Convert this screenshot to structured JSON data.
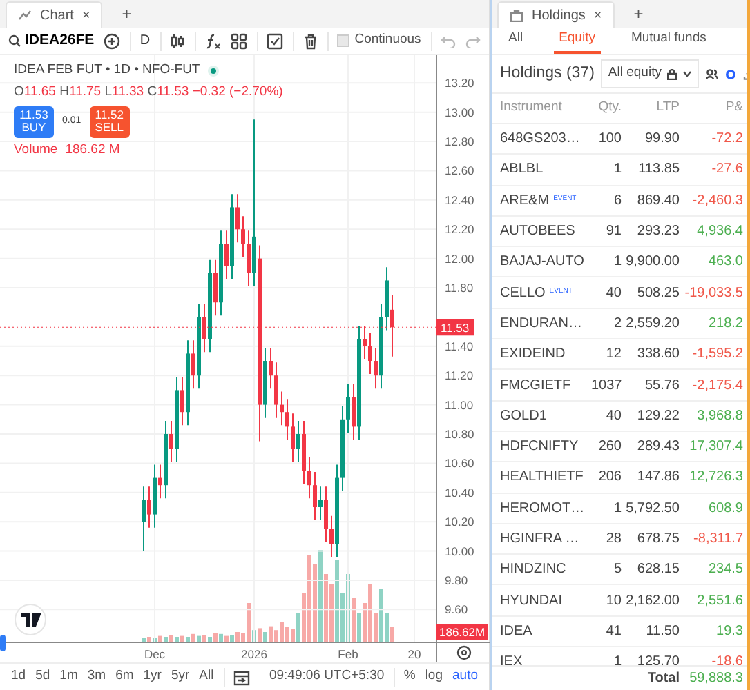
{
  "chart_tab": {
    "title": "Chart",
    "close": "×",
    "add": "+"
  },
  "toolbar": {
    "symbol": "IDEA26FE",
    "interval": "D",
    "continuous": {
      "label": "Continuous",
      "checked": false
    }
  },
  "legend": {
    "title": "IDEA FEB FUT • 1D • NFO-FUT",
    "ohlc": [
      {
        "label": "O",
        "value": "11.65"
      },
      {
        "label": "H",
        "value": "11.75"
      },
      {
        "label": "L",
        "value": "11.33"
      },
      {
        "label": "C",
        "value": "11.53"
      }
    ],
    "change": "−0.32 (−2.70%)",
    "buy": {
      "price": "11.53",
      "label": "BUY"
    },
    "spread": "0.01",
    "sell": {
      "price": "11.52",
      "label": "SELL"
    },
    "volume": {
      "label": "Volume",
      "value": "186.62 M"
    }
  },
  "chart": {
    "chart_data": {
      "type": "candlestick",
      "grid": true,
      "categories": [
        null,
        null,
        "Dec",
        null,
        null,
        null,
        null,
        null,
        null,
        null,
        null,
        null,
        null,
        null,
        null,
        null,
        null,
        null,
        null,
        null,
        "2026",
        null,
        null,
        null,
        null,
        null,
        null,
        null,
        null,
        null,
        null,
        null,
        null,
        null,
        null,
        null,
        null,
        "Feb",
        null,
        null,
        null,
        null,
        null,
        null,
        null,
        null,
        null,
        null,
        null,
        "20"
      ],
      "ohlc": [
        [
          10.2,
          10.44,
          10.0,
          10.35
        ],
        [
          10.35,
          10.44,
          10.16,
          10.25
        ],
        [
          10.25,
          10.59,
          10.16,
          10.5
        ],
        [
          10.5,
          10.59,
          10.36,
          10.45
        ],
        [
          10.45,
          10.89,
          10.36,
          10.8
        ],
        [
          10.8,
          10.89,
          10.61,
          10.7
        ],
        [
          10.7,
          11.19,
          10.61,
          11.1
        ],
        [
          11.1,
          11.19,
          10.86,
          10.95
        ],
        [
          10.95,
          11.44,
          10.86,
          11.35
        ],
        [
          11.35,
          11.44,
          11.11,
          11.2
        ],
        [
          11.2,
          11.69,
          11.11,
          11.6
        ],
        [
          11.6,
          11.69,
          11.36,
          11.45
        ],
        [
          11.45,
          11.99,
          11.36,
          11.9
        ],
        [
          11.9,
          11.99,
          11.61,
          11.7
        ],
        [
          11.7,
          12.19,
          11.61,
          12.1
        ],
        [
          12.1,
          12.19,
          11.86,
          11.95
        ],
        [
          11.95,
          12.44,
          11.86,
          12.35
        ],
        [
          12.35,
          12.44,
          12.11,
          12.2
        ],
        [
          12.2,
          12.29,
          12.01,
          12.1
        ],
        [
          12.1,
          12.19,
          11.81,
          11.9
        ],
        [
          11.9,
          12.95,
          11.81,
          12.15
        ],
        [
          12.0,
          12.09,
          10.75,
          11.0
        ],
        [
          11.0,
          11.39,
          10.91,
          11.3
        ],
        [
          11.3,
          11.39,
          11.11,
          11.2
        ],
        [
          11.2,
          11.29,
          10.91,
          11.0
        ],
        [
          11.0,
          11.09,
          10.86,
          10.95
        ],
        [
          10.95,
          11.04,
          10.76,
          10.85
        ],
        [
          10.85,
          10.94,
          10.61,
          10.7
        ],
        [
          10.7,
          10.89,
          10.61,
          10.8
        ],
        [
          10.8,
          10.89,
          10.46,
          10.55
        ],
        [
          10.55,
          10.64,
          10.36,
          10.45
        ],
        [
          10.45,
          10.54,
          10.21,
          10.3
        ],
        [
          10.3,
          10.44,
          10.21,
          10.35
        ],
        [
          10.35,
          10.44,
          10.06,
          10.15
        ],
        [
          10.15,
          10.24,
          9.96,
          10.05
        ],
        [
          10.05,
          10.59,
          9.96,
          10.5
        ],
        [
          10.5,
          10.99,
          10.41,
          10.9
        ],
        [
          10.9,
          11.14,
          10.81,
          11.05
        ],
        [
          11.05,
          11.14,
          10.76,
          10.85
        ],
        [
          10.85,
          11.54,
          10.76,
          11.45
        ],
        [
          11.45,
          11.54,
          11.31,
          11.4
        ],
        [
          11.4,
          11.49,
          11.21,
          11.3
        ],
        [
          11.3,
          11.39,
          11.11,
          11.2
        ],
        [
          11.2,
          11.69,
          11.11,
          11.6
        ],
        [
          11.6,
          11.94,
          11.51,
          11.85
        ],
        [
          11.65,
          11.75,
          11.33,
          11.53
        ],
        null,
        null,
        null,
        null
      ],
      "ylim": [
        9.38,
        13.39
      ],
      "yticks": [
        {
          "value": 13.2,
          "label": "13.20"
        },
        {
          "value": 13.0,
          "label": "13.00"
        },
        {
          "value": 12.8,
          "label": "12.80"
        },
        {
          "value": 12.6,
          "label": "12.60"
        },
        {
          "value": 12.4,
          "label": "12.40"
        },
        {
          "value": 12.2,
          "label": "12.20"
        },
        {
          "value": 12.0,
          "label": "12.00"
        },
        {
          "value": 11.8,
          "label": "11.80"
        },
        {
          "value": 11.4,
          "label": "11.40"
        },
        {
          "value": 11.2,
          "label": "11.20"
        },
        {
          "value": 11.0,
          "label": "11.00"
        },
        {
          "value": 10.8,
          "label": "10.80"
        },
        {
          "value": 10.6,
          "label": "10.60"
        },
        {
          "value": 10.4,
          "label": "10.40"
        },
        {
          "value": 10.2,
          "label": "10.20"
        },
        {
          "value": 10.0,
          "label": "10.00"
        },
        {
          "value": 9.8,
          "label": "9.80"
        },
        {
          "value": 9.6,
          "label": "9.60"
        }
      ]
    },
    "last_price": "11.53",
    "last_volume": "186.62M"
  },
  "range_bar": {
    "ranges": [
      "1d",
      "5d",
      "1m",
      "3m",
      "6m",
      "1yr",
      "5yr",
      "All"
    ],
    "time": "09:49:06 UTC+5:30",
    "toggles": [
      {
        "label": "%",
        "selected": false
      },
      {
        "label": "log",
        "selected": false
      },
      {
        "label": "auto",
        "selected": true
      }
    ]
  },
  "holdings_tab": {
    "title": "Holdings",
    "close": "×",
    "add": "+"
  },
  "segments": [
    {
      "label": "All",
      "selected": false
    },
    {
      "label": "Equity",
      "selected": true
    },
    {
      "label": "Mutual funds",
      "selected": false
    }
  ],
  "holdings": {
    "title": "Holdings (37)",
    "filter": "All equity",
    "columns": [
      "Instrument",
      "Qty.",
      "LTP",
      "P&"
    ],
    "rows": [
      {
        "instrument": "648GS203…",
        "qty": "100",
        "ltp": "99.90",
        "pnl": "-72.2",
        "color": "#f0584a"
      },
      {
        "instrument": "ABLBL",
        "qty": "1",
        "ltp": "113.85",
        "pnl": "-27.6",
        "color": "#f0584a"
      },
      {
        "instrument": "ARE&M",
        "event": "EVENT",
        "qty": "6",
        "ltp": "869.40",
        "pnl": "-2,460.3",
        "color": "#f0584a"
      },
      {
        "instrument": "AUTOBEES",
        "qty": "91",
        "ltp": "293.23",
        "pnl": "4,936.4",
        "color": "#4caf50"
      },
      {
        "instrument": "BAJAJ-AUTO",
        "qty": "1",
        "ltp": "9,900.00",
        "pnl": "463.0",
        "color": "#4caf50"
      },
      {
        "instrument": "CELLO",
        "event": "EVENT",
        "qty": "40",
        "ltp": "508.25",
        "pnl": "-19,033.5",
        "color": "#f0584a"
      },
      {
        "instrument": "ENDURAN…",
        "qty": "2",
        "ltp": "2,559.20",
        "pnl": "218.2",
        "color": "#4caf50"
      },
      {
        "instrument": "EXIDEIND",
        "qty": "12",
        "ltp": "338.60",
        "pnl": "-1,595.2",
        "color": "#f0584a"
      },
      {
        "instrument": "FMCGIETF",
        "qty": "1037",
        "ltp": "55.76",
        "pnl": "-2,175.4",
        "color": "#f0584a"
      },
      {
        "instrument": "GOLD1",
        "qty": "40",
        "ltp": "129.22",
        "pnl": "3,968.8",
        "color": "#4caf50"
      },
      {
        "instrument": "HDFCNIFTY",
        "qty": "260",
        "ltp": "289.43",
        "pnl": "17,307.4",
        "color": "#4caf50"
      },
      {
        "instrument": "HEALTHIETF",
        "qty": "206",
        "ltp": "147.86",
        "pnl": "12,726.3",
        "color": "#4caf50"
      },
      {
        "instrument": "HEROMOT…",
        "qty": "1",
        "ltp": "5,792.50",
        "pnl": "608.9",
        "color": "#4caf50"
      },
      {
        "instrument": "HGINFRA …",
        "qty": "28",
        "ltp": "678.75",
        "pnl": "-8,311.7",
        "color": "#f0584a"
      },
      {
        "instrument": "HINDZINC",
        "qty": "5",
        "ltp": "628.15",
        "pnl": "234.5",
        "color": "#4caf50"
      },
      {
        "instrument": "HYUNDAI",
        "qty": "10",
        "ltp": "2,162.00",
        "pnl": "2,551.6",
        "color": "#4caf50"
      },
      {
        "instrument": "IDEA",
        "qty": "41",
        "ltp": "11.50",
        "pnl": "19.3",
        "color": "#4caf50"
      },
      {
        "instrument": "IEX",
        "qty": "1",
        "ltp": "125.70",
        "pnl": "-18.6",
        "color": "#f0584a"
      }
    ],
    "total": {
      "label": "Total",
      "value": "59,888.3"
    }
  }
}
